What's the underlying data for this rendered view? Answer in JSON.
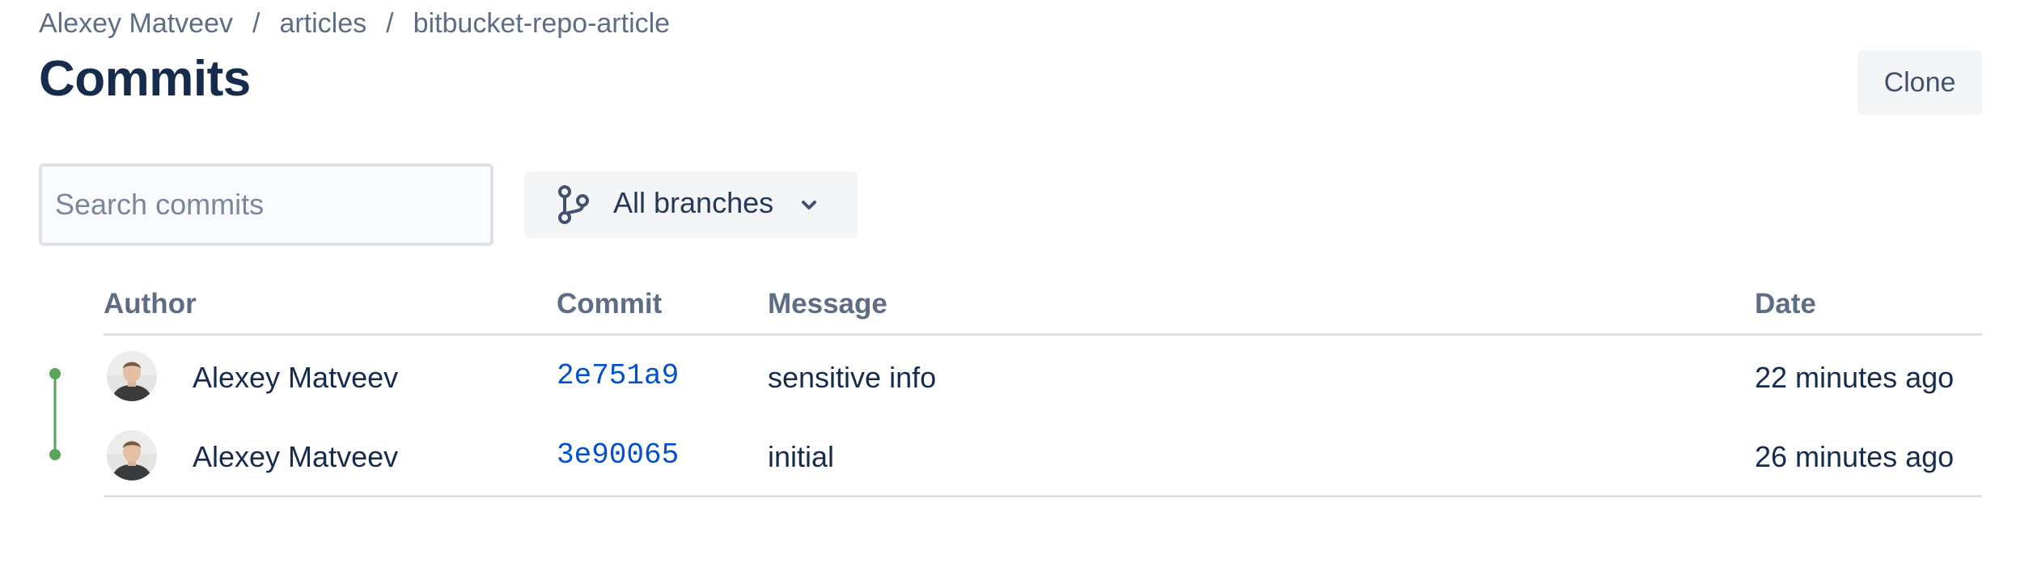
{
  "breadcrumb": {
    "items": [
      "Alexey Matveev",
      "articles",
      "bitbucket-repo-article"
    ],
    "separator": "/"
  },
  "page": {
    "title": "Commits"
  },
  "toolbar": {
    "clone_label": "Clone"
  },
  "search": {
    "placeholder": "Search commits",
    "value": ""
  },
  "branch_filter": {
    "selected": "All branches",
    "icon": "branch-icon"
  },
  "table": {
    "columns": [
      "Author",
      "Commit",
      "Message",
      "Date"
    ],
    "rows": [
      {
        "author": "Alexey Matveev",
        "commit": "2e751a9",
        "message": "sensitive info",
        "date": "22 minutes ago"
      },
      {
        "author": "Alexey Matveev",
        "commit": "3e90065",
        "message": "initial",
        "date": "26 minutes ago"
      }
    ]
  },
  "colors": {
    "graph_line": "#57a55a",
    "commit_link": "#0052cc",
    "title_text": "#172b4d",
    "muted_text": "#5e6c84",
    "button_bg": "#f4f5f7"
  }
}
